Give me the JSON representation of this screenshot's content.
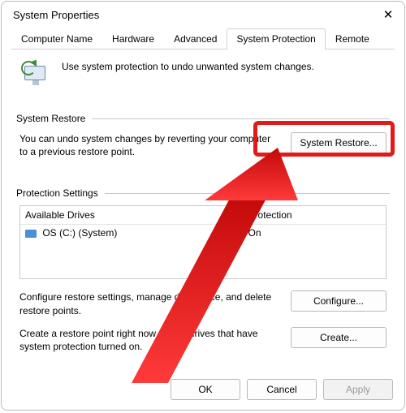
{
  "window": {
    "title": "System Properties"
  },
  "tabs": [
    "Computer Name",
    "Hardware",
    "Advanced",
    "System Protection",
    "Remote"
  ],
  "active_tab_index": 3,
  "intro": "Use system protection to undo unwanted system changes.",
  "groups": {
    "restore": {
      "title": "System Restore",
      "desc": "You can undo system changes by reverting your computer to a previous restore point.",
      "button": "System Restore..."
    },
    "protection": {
      "title": "Protection Settings",
      "columns": {
        "drive": "Available Drives",
        "protection": "Protection"
      },
      "rows": [
        {
          "drive": "OS (C:) (System)",
          "protection": "On"
        }
      ],
      "configure_desc": "Configure restore settings, manage disk space, and delete restore points.",
      "configure_button": "Configure...",
      "create_desc": "Create a restore point right now for the drives that have system protection turned on.",
      "create_button": "Create..."
    }
  },
  "footer": {
    "ok": "OK",
    "cancel": "Cancel",
    "apply": "Apply"
  },
  "annotation": {
    "highlight": "system-restore-button"
  }
}
